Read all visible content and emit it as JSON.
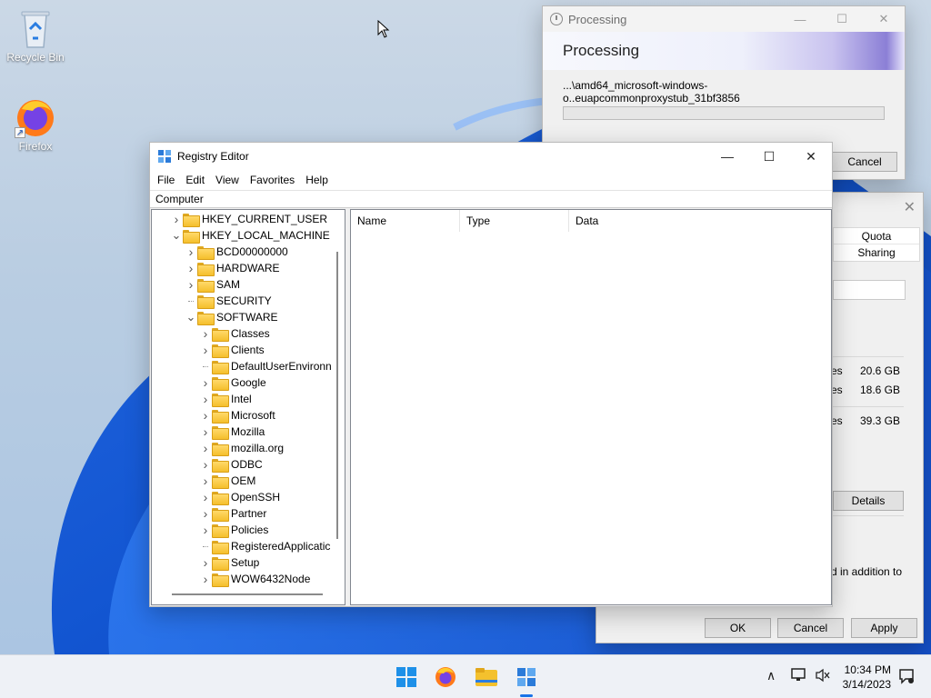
{
  "desktop": {
    "icons": [
      {
        "label": "Recycle Bin",
        "icon": "recycle-bin-icon"
      },
      {
        "label": "Firefox",
        "icon": "firefox-icon"
      }
    ]
  },
  "processing_dialog": {
    "title": "Processing",
    "heading": "Processing",
    "path": "...\\amd64_microsoft-windows-o..euapcommonproxystub_31bf3856",
    "progress": 0.0,
    "cancel_label": "Cancel"
  },
  "properties_dialog": {
    "tabs": [
      "Quota",
      "Sharing"
    ],
    "rows": [
      {
        "suffix": "es",
        "value": "20.6 GB"
      },
      {
        "suffix": "es",
        "value": "18.6 GB"
      },
      {
        "suffix": "es",
        "value": "39.3 GB"
      }
    ],
    "details_label": "Details",
    "note_fragment": "d in addition to",
    "ok_label": "OK",
    "cancel_label": "Cancel",
    "apply_label": "Apply"
  },
  "registry_editor": {
    "title": "Registry Editor",
    "menu": [
      "File",
      "Edit",
      "View",
      "Favorites",
      "Help"
    ],
    "address": "Computer",
    "tree": [
      {
        "label": "HKEY_CURRENT_USER",
        "level": 1,
        "expander": "collapsed"
      },
      {
        "label": "HKEY_LOCAL_MACHINE",
        "level": 1,
        "expander": "expanded"
      },
      {
        "label": "BCD00000000",
        "level": 2,
        "expander": "collapsed"
      },
      {
        "label": "HARDWARE",
        "level": 2,
        "expander": "collapsed"
      },
      {
        "label": "SAM",
        "level": 2,
        "expander": "collapsed"
      },
      {
        "label": "SECURITY",
        "level": 2,
        "expander": "none"
      },
      {
        "label": "SOFTWARE",
        "level": 2,
        "expander": "expanded"
      },
      {
        "label": "Classes",
        "level": 3,
        "expander": "collapsed"
      },
      {
        "label": "Clients",
        "level": 3,
        "expander": "collapsed"
      },
      {
        "label": "DefaultUserEnvironn",
        "level": 3,
        "expander": "none"
      },
      {
        "label": "Google",
        "level": 3,
        "expander": "collapsed"
      },
      {
        "label": "Intel",
        "level": 3,
        "expander": "collapsed"
      },
      {
        "label": "Microsoft",
        "level": 3,
        "expander": "collapsed"
      },
      {
        "label": "Mozilla",
        "level": 3,
        "expander": "collapsed"
      },
      {
        "label": "mozilla.org",
        "level": 3,
        "expander": "collapsed"
      },
      {
        "label": "ODBC",
        "level": 3,
        "expander": "collapsed"
      },
      {
        "label": "OEM",
        "level": 3,
        "expander": "collapsed"
      },
      {
        "label": "OpenSSH",
        "level": 3,
        "expander": "collapsed"
      },
      {
        "label": "Partner",
        "level": 3,
        "expander": "collapsed"
      },
      {
        "label": "Policies",
        "level": 3,
        "expander": "collapsed"
      },
      {
        "label": "RegisteredApplicatic",
        "level": 3,
        "expander": "none"
      },
      {
        "label": "Setup",
        "level": 3,
        "expander": "collapsed"
      },
      {
        "label": "WOW6432Node",
        "level": 3,
        "expander": "collapsed"
      }
    ],
    "columns": [
      "Name",
      "Type",
      "Data"
    ]
  },
  "taskbar": {
    "apps": [
      "start-icon",
      "firefox-icon",
      "file-explorer-icon",
      "registry-editor-icon"
    ],
    "time": "10:34 PM",
    "date": "3/14/2023"
  }
}
